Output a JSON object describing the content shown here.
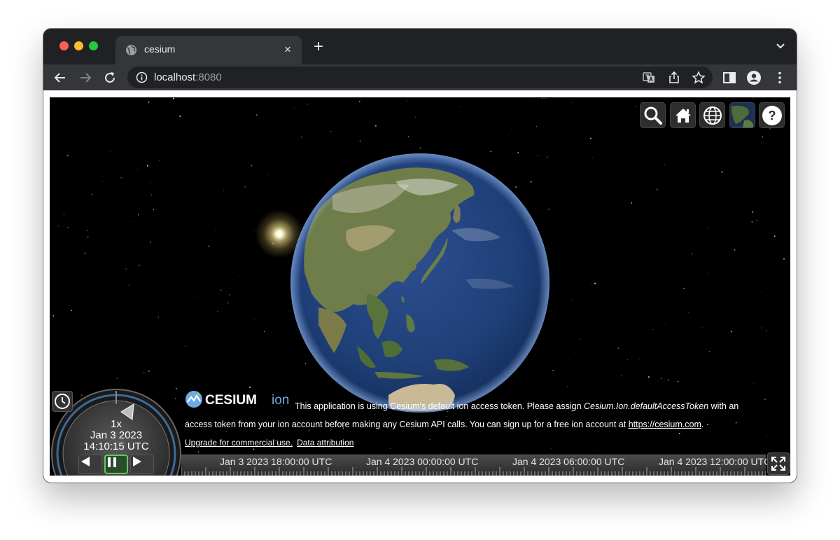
{
  "browser": {
    "tab_title": "cesium",
    "tab_close": "×",
    "new_tab": "+",
    "url_host": "localhost",
    "url_port": ":8080"
  },
  "viewer": {
    "logo_text": "CESIUM",
    "logo_suffix": "ion",
    "help_label": "?",
    "credit_line1_pre": "This application is using Cesium's default ion access token. Please assign ",
    "credit_line1_token": "Cesium.Ion.defaultAccessToken",
    "credit_line1_post": " with an",
    "credit_line2_pre": "access token from your ion account before making any Cesium API calls. You can sign up for a free ion account at ",
    "credit_line2_link": "https://cesium.com",
    "credit_line2_post": ". ·",
    "upgrade_link": "Upgrade for commercial use.",
    "attribution_link": "Data attribution"
  },
  "animation": {
    "speed": "1x",
    "date": "Jan 3 2023",
    "time": "14:10:15 UTC"
  },
  "timeline": {
    "labels": [
      "Jan 3 2023 18:00:00 UTC",
      "Jan 4 2023 00:00:00 UTC",
      "Jan 4 2023 06:00:00 UTC",
      "Jan 4 2023 12:00:00 UTC"
    ]
  },
  "colors": {
    "pause_accent": "#5ecb5e",
    "ocean": "#1f3f78",
    "land": "#6f7d4a"
  }
}
